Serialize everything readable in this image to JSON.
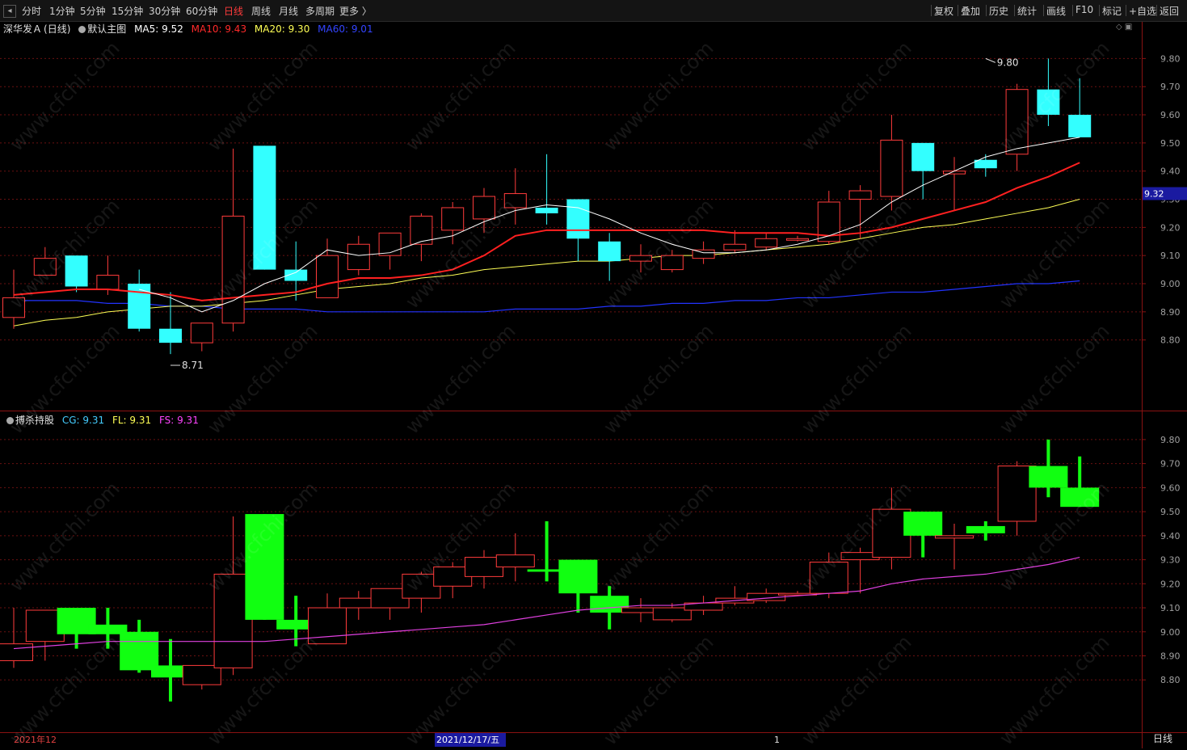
{
  "toolbar": {
    "periods": [
      "分时",
      "1分钟",
      "5分钟",
      "15分钟",
      "30分钟",
      "60分钟",
      "日线",
      "周线",
      "月线",
      "多周期",
      "更多 〉"
    ],
    "active_period": "日线",
    "right_buttons": [
      "复权",
      "叠加",
      "历史",
      "统计",
      "画线",
      "F10",
      "标记",
      "+自选",
      "返回"
    ]
  },
  "main_legend": {
    "stock": "深华发Ａ",
    "period": "(日线)",
    "template": "默认主图",
    "ma5": "MA5: 9.52",
    "ma10": "MA10: 9.43",
    "ma20": "MA20: 9.30",
    "ma60": "MA60: 9.01"
  },
  "sub_legend": {
    "name": "搏杀持股",
    "cg": "CG: 9.31",
    "fl": "FL: 9.31",
    "fs": "FS: 9.31"
  },
  "colors": {
    "up": "#ff3b3b",
    "down_main": "#33ffff",
    "down_sub": "#11ff11",
    "ma5": "#ffffff",
    "ma10": "#ff2020",
    "ma20": "#ffff55",
    "ma60": "#2233ff",
    "fs_line": "#e040e0",
    "grid": "#6a1010",
    "price_tag_bg": "#1a1aa0"
  },
  "watermark": "www.cfchi.com",
  "period_label": "日线",
  "chart_data": [
    {
      "type": "candlestick",
      "name": "main",
      "y_ticks": [
        "9.80",
        "9.70",
        "9.60",
        "9.50",
        "9.40",
        "9.30",
        "9.20",
        "9.10",
        "9.00",
        "8.90",
        "8.80"
      ],
      "ylim": [
        8.71,
        9.87
      ],
      "current_price_tag": "9.32",
      "current_price": 9.32,
      "annotations": [
        {
          "text": "9.80",
          "value": 9.8,
          "bar": 31
        },
        {
          "text": "8.71",
          "value": 8.71,
          "bar": 5
        }
      ],
      "candles": [
        {
          "o": 8.88,
          "h": 9.05,
          "l": 8.84,
          "c": 8.95
        },
        {
          "o": 9.03,
          "h": 9.13,
          "l": 9.03,
          "c": 9.09
        },
        {
          "o": 9.1,
          "h": 9.1,
          "l": 8.97,
          "c": 8.99
        },
        {
          "o": 8.98,
          "h": 9.1,
          "l": 8.96,
          "c": 9.03
        },
        {
          "o": 9.0,
          "h": 9.05,
          "l": 8.83,
          "c": 8.84
        },
        {
          "o": 8.84,
          "h": 8.97,
          "l": 8.75,
          "c": 8.79
        },
        {
          "o": 8.79,
          "h": 8.86,
          "l": 8.76,
          "c": 8.86
        },
        {
          "o": 8.86,
          "h": 9.48,
          "l": 8.83,
          "c": 9.24
        },
        {
          "o": 9.49,
          "h": 9.49,
          "l": 9.05,
          "c": 9.05
        },
        {
          "o": 9.05,
          "h": 9.15,
          "l": 8.94,
          "c": 9.01
        },
        {
          "o": 8.95,
          "h": 9.16,
          "l": 8.95,
          "c": 9.1
        },
        {
          "o": 9.05,
          "h": 9.17,
          "l": 9.03,
          "c": 9.14
        },
        {
          "o": 9.1,
          "h": 9.17,
          "l": 9.05,
          "c": 9.18
        },
        {
          "o": 9.14,
          "h": 9.25,
          "l": 9.08,
          "c": 9.24
        },
        {
          "o": 9.19,
          "h": 9.29,
          "l": 9.14,
          "c": 9.27
        },
        {
          "o": 9.23,
          "h": 9.34,
          "l": 9.18,
          "c": 9.31
        },
        {
          "o": 9.27,
          "h": 9.41,
          "l": 9.21,
          "c": 9.32
        },
        {
          "o": 9.27,
          "h": 9.46,
          "l": 9.21,
          "c": 9.25
        },
        {
          "o": 9.3,
          "h": 9.3,
          "l": 9.08,
          "c": 9.16
        },
        {
          "o": 9.15,
          "h": 9.18,
          "l": 9.01,
          "c": 9.08
        },
        {
          "o": 9.08,
          "h": 9.14,
          "l": 9.04,
          "c": 9.1
        },
        {
          "o": 9.05,
          "h": 9.12,
          "l": 9.04,
          "c": 9.1
        },
        {
          "o": 9.09,
          "h": 9.15,
          "l": 9.07,
          "c": 9.12
        },
        {
          "o": 9.12,
          "h": 9.19,
          "l": 9.11,
          "c": 9.14
        },
        {
          "o": 9.13,
          "h": 9.18,
          "l": 9.12,
          "c": 9.16
        },
        {
          "o": 9.16,
          "h": 9.17,
          "l": 9.15,
          "c": 9.16
        },
        {
          "o": 9.15,
          "h": 9.33,
          "l": 9.14,
          "c": 9.29
        },
        {
          "o": 9.3,
          "h": 9.35,
          "l": 9.16,
          "c": 9.33
        },
        {
          "o": 9.31,
          "h": 9.6,
          "l": 9.26,
          "c": 9.51
        },
        {
          "o": 9.5,
          "h": 9.5,
          "l": 9.3,
          "c": 9.4
        },
        {
          "o": 9.39,
          "h": 9.45,
          "l": 9.26,
          "c": 9.4
        },
        {
          "o": 9.44,
          "h": 9.46,
          "l": 9.38,
          "c": 9.41
        },
        {
          "o": 9.46,
          "h": 9.71,
          "l": 9.4,
          "c": 9.69
        },
        {
          "o": 9.69,
          "h": 9.8,
          "l": 9.56,
          "c": 9.6
        },
        {
          "o": 9.6,
          "h": 9.73,
          "l": 9.52,
          "c": 9.52
        }
      ],
      "ma5": [
        null,
        null,
        null,
        null,
        8.98,
        8.95,
        8.9,
        8.94,
        9.0,
        9.04,
        9.12,
        9.1,
        9.11,
        9.15,
        9.17,
        9.22,
        9.26,
        9.28,
        9.27,
        9.23,
        9.18,
        9.14,
        9.11,
        9.11,
        9.12,
        9.14,
        9.17,
        9.21,
        9.29,
        9.35,
        9.4,
        9.45,
        9.48,
        9.5,
        9.52
      ],
      "ma10": [
        8.96,
        8.97,
        8.98,
        8.98,
        8.97,
        8.96,
        8.94,
        8.95,
        8.96,
        8.97,
        9.0,
        9.02,
        9.02,
        9.03,
        9.05,
        9.1,
        9.17,
        9.19,
        9.19,
        9.19,
        9.19,
        9.19,
        9.19,
        9.18,
        9.18,
        9.18,
        9.17,
        9.18,
        9.2,
        9.23,
        9.26,
        9.29,
        9.34,
        9.38,
        9.43
      ],
      "ma20": [
        8.85,
        8.87,
        8.88,
        8.9,
        8.91,
        8.92,
        8.92,
        8.93,
        8.94,
        8.96,
        8.98,
        8.99,
        9.0,
        9.02,
        9.03,
        9.05,
        9.06,
        9.07,
        9.08,
        9.08,
        9.09,
        9.1,
        9.1,
        9.11,
        9.12,
        9.13,
        9.14,
        9.16,
        9.18,
        9.2,
        9.21,
        9.23,
        9.25,
        9.27,
        9.3
      ],
      "ma60": [
        8.94,
        8.94,
        8.94,
        8.93,
        8.93,
        8.92,
        8.92,
        8.91,
        8.91,
        8.91,
        8.9,
        8.9,
        8.9,
        8.9,
        8.9,
        8.9,
        8.91,
        8.91,
        8.91,
        8.92,
        8.92,
        8.93,
        8.93,
        8.94,
        8.94,
        8.95,
        8.95,
        8.96,
        8.97,
        8.97,
        8.98,
        8.99,
        9.0,
        9.0,
        9.01
      ]
    },
    {
      "type": "candlestick",
      "name": "搏杀持股",
      "y_ticks": [
        "9.80",
        "9.70",
        "9.60",
        "9.50",
        "9.40",
        "9.30",
        "9.20",
        "9.10",
        "9.00",
        "8.90",
        "8.80"
      ],
      "ylim": [
        8.71,
        9.84
      ],
      "candles": [
        {
          "o": 8.88,
          "h": 9.1,
          "l": 8.85,
          "c": 8.95
        },
        {
          "o": 8.96,
          "h": 9.09,
          "l": 8.88,
          "c": 9.09
        },
        {
          "o": 9.1,
          "h": 9.1,
          "l": 8.93,
          "c": 8.99
        },
        {
          "o": 9.03,
          "h": 9.1,
          "l": 8.93,
          "c": 8.99
        },
        {
          "o": 9.0,
          "h": 9.05,
          "l": 8.83,
          "c": 8.84
        },
        {
          "o": 8.86,
          "h": 8.97,
          "l": 8.71,
          "c": 8.81
        },
        {
          "o": 8.78,
          "h": 8.86,
          "l": 8.76,
          "c": 8.86
        },
        {
          "o": 8.85,
          "h": 9.48,
          "l": 8.82,
          "c": 9.24
        },
        {
          "o": 9.49,
          "h": 9.49,
          "l": 9.05,
          "c": 9.05
        },
        {
          "o": 9.05,
          "h": 9.15,
          "l": 8.94,
          "c": 9.01
        },
        {
          "o": 8.95,
          "h": 9.16,
          "l": 8.95,
          "c": 9.1
        },
        {
          "o": 9.1,
          "h": 9.17,
          "l": 9.05,
          "c": 9.14
        },
        {
          "o": 9.1,
          "h": 9.17,
          "l": 9.05,
          "c": 9.18
        },
        {
          "o": 9.14,
          "h": 9.25,
          "l": 9.08,
          "c": 9.24
        },
        {
          "o": 9.19,
          "h": 9.29,
          "l": 9.14,
          "c": 9.27
        },
        {
          "o": 9.23,
          "h": 9.34,
          "l": 9.18,
          "c": 9.31
        },
        {
          "o": 9.27,
          "h": 9.41,
          "l": 9.21,
          "c": 9.32
        },
        {
          "o": 9.26,
          "h": 9.46,
          "l": 9.21,
          "c": 9.25
        },
        {
          "o": 9.3,
          "h": 9.3,
          "l": 9.08,
          "c": 9.16
        },
        {
          "o": 9.15,
          "h": 9.19,
          "l": 9.01,
          "c": 9.08
        },
        {
          "o": 9.08,
          "h": 9.14,
          "l": 9.04,
          "c": 9.1
        },
        {
          "o": 9.05,
          "h": 9.12,
          "l": 9.04,
          "c": 9.1
        },
        {
          "o": 9.09,
          "h": 9.15,
          "l": 9.07,
          "c": 9.12
        },
        {
          "o": 9.12,
          "h": 9.19,
          "l": 9.11,
          "c": 9.14
        },
        {
          "o": 9.13,
          "h": 9.18,
          "l": 9.12,
          "c": 9.16
        },
        {
          "o": 9.16,
          "h": 9.17,
          "l": 9.15,
          "c": 9.16
        },
        {
          "o": 9.16,
          "h": 9.33,
          "l": 9.14,
          "c": 9.29
        },
        {
          "o": 9.3,
          "h": 9.35,
          "l": 9.16,
          "c": 9.33
        },
        {
          "o": 9.31,
          "h": 9.6,
          "l": 9.26,
          "c": 9.51
        },
        {
          "o": 9.5,
          "h": 9.5,
          "l": 9.31,
          "c": 9.4
        },
        {
          "o": 9.39,
          "h": 9.45,
          "l": 9.26,
          "c": 9.4
        },
        {
          "o": 9.44,
          "h": 9.46,
          "l": 9.38,
          "c": 9.41
        },
        {
          "o": 9.46,
          "h": 9.71,
          "l": 9.4,
          "c": 9.69
        },
        {
          "o": 9.69,
          "h": 9.8,
          "l": 9.56,
          "c": 9.6
        },
        {
          "o": 9.6,
          "h": 9.73,
          "l": 9.52,
          "c": 9.52
        }
      ],
      "fs": [
        8.93,
        8.94,
        8.95,
        8.96,
        8.96,
        8.96,
        8.96,
        8.96,
        8.96,
        8.97,
        8.98,
        8.99,
        9.0,
        9.01,
        9.02,
        9.03,
        9.05,
        9.07,
        9.09,
        9.1,
        9.11,
        9.11,
        9.12,
        9.13,
        9.14,
        9.15,
        9.16,
        9.17,
        9.2,
        9.22,
        9.23,
        9.24,
        9.26,
        9.28,
        9.31
      ]
    }
  ],
  "x_labels": [
    "2021年12",
    "2021/12/17/五",
    "1"
  ]
}
